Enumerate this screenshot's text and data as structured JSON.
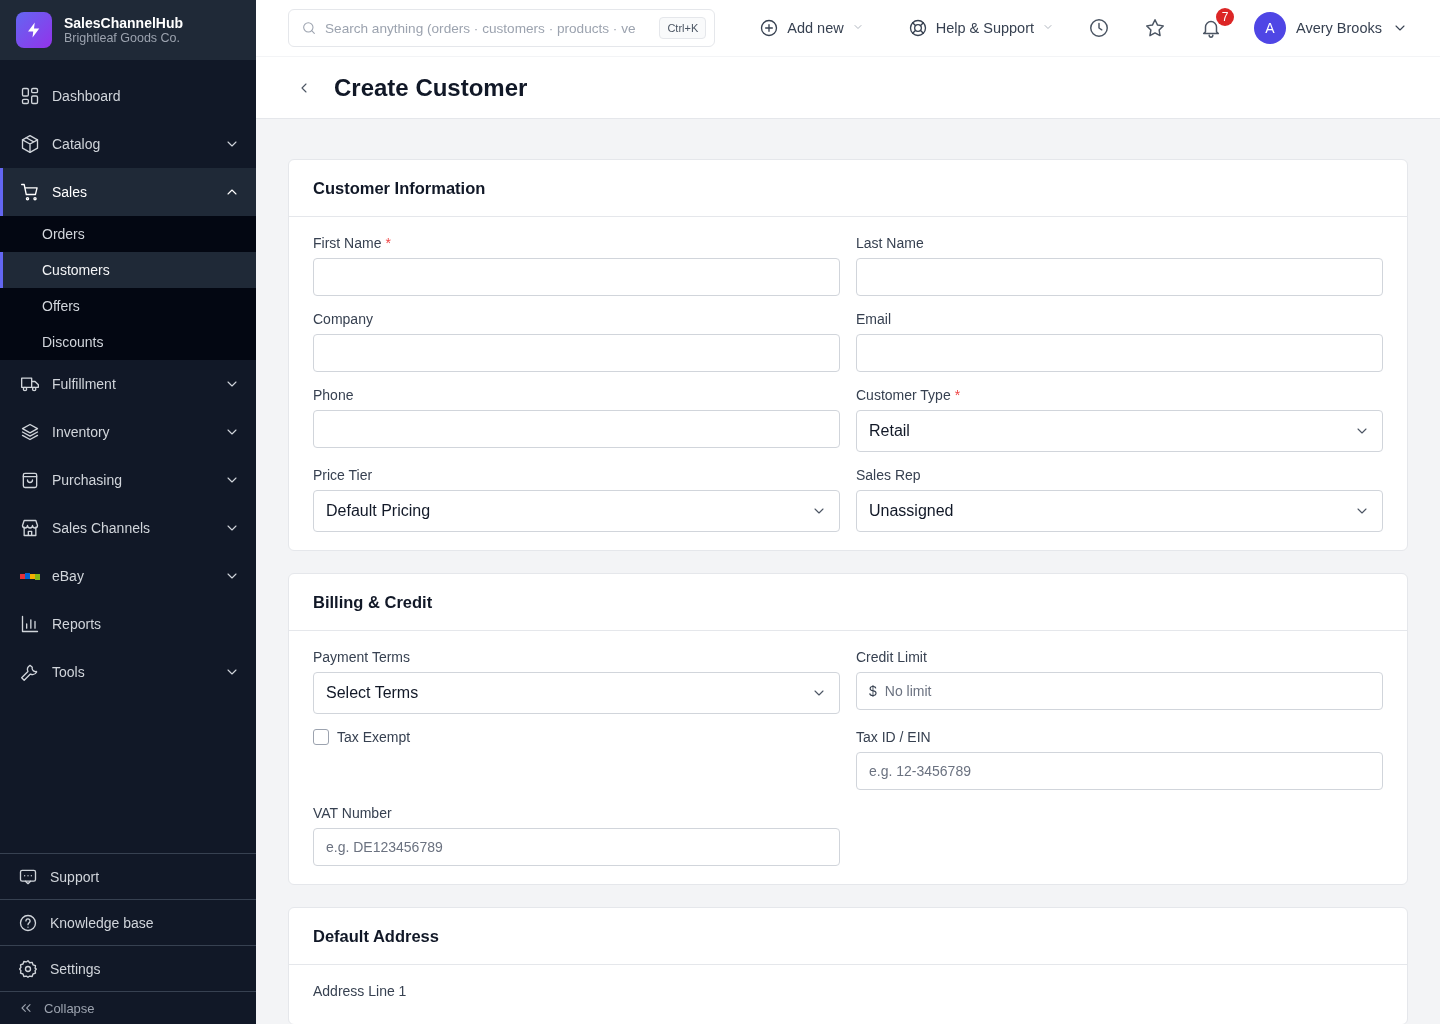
{
  "brand": {
    "name": "SalesChannelHub",
    "company": "Brightleaf Goods Co."
  },
  "nav": [
    {
      "label": "Dashboard",
      "selected": false
    },
    {
      "label": "Catalog",
      "selected": false,
      "expanded": false
    },
    {
      "label": "Sales",
      "selected": true,
      "expanded": true,
      "children": [
        {
          "label": "Orders",
          "selected": false
        },
        {
          "label": "Customers",
          "selected": true
        },
        {
          "label": "Offers",
          "selected": false
        },
        {
          "label": "Discounts",
          "selected": false
        }
      ]
    },
    {
      "label": "Fulfillment",
      "selected": false,
      "expanded": false
    },
    {
      "label": "Inventory",
      "selected": false,
      "expanded": false
    },
    {
      "label": "Purchasing",
      "selected": false,
      "expanded": false
    },
    {
      "label": "Sales Channels",
      "selected": false,
      "expanded": false
    },
    {
      "label": "eBay",
      "selected": false,
      "expanded": false
    },
    {
      "label": "Reports",
      "selected": false
    },
    {
      "label": "Tools",
      "selected": false,
      "expanded": false
    }
  ],
  "footer_links": [
    {
      "label": "Support"
    },
    {
      "label": "Knowledge base"
    },
    {
      "label": "Settings"
    }
  ],
  "collapse": {
    "label": "Collapse"
  },
  "topbar": {
    "search": {
      "placeholder": "Search anything (orders · customers · products · ve",
      "shortcut": "Ctrl+K"
    },
    "add_new": "Add new",
    "help": "Help & Support",
    "notifications": "7",
    "user": {
      "initial": "A",
      "name": "Avery Brooks"
    }
  },
  "page": {
    "title": "Create Customer"
  },
  "sections": [
    {
      "title": "Customer Information",
      "rows": [
        [
          {
            "kind": "text",
            "label": "First Name",
            "required_mark": "*"
          },
          {
            "kind": "text",
            "label": "Last Name"
          }
        ],
        [
          {
            "kind": "text",
            "label": "Company"
          },
          {
            "kind": "text",
            "label": "Email"
          }
        ],
        [
          {
            "kind": "text",
            "label": "Phone"
          },
          {
            "kind": "select",
            "label": "Customer Type",
            "required_mark": "*",
            "value": "Retail"
          }
        ],
        [
          {
            "kind": "select",
            "label": "Price Tier",
            "value": "Default Pricing"
          },
          {
            "kind": "select",
            "label": "Sales Rep",
            "value": "Unassigned"
          }
        ]
      ]
    },
    {
      "title": "Billing & Credit",
      "rows": [
        [
          {
            "kind": "select",
            "label": "Payment Terms",
            "value": "Select Terms"
          },
          {
            "kind": "money",
            "label": "Credit Limit",
            "prefix": "$",
            "placeholder": "No limit"
          }
        ],
        [
          {
            "kind": "checkbox",
            "label": "Tax Exempt",
            "checked": false
          },
          {
            "kind": "text",
            "label": "Tax ID / EIN",
            "placeholder": "e.g. 12-3456789"
          }
        ],
        [
          {
            "kind": "text",
            "label": "VAT Number",
            "placeholder": "e.g. DE123456789"
          }
        ]
      ]
    },
    {
      "title": "Default Address",
      "rows": [
        [
          {
            "kind": "label",
            "label": "Address Line 1"
          }
        ]
      ]
    }
  ]
}
